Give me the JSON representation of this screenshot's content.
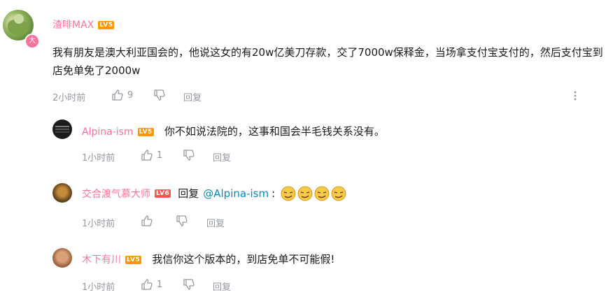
{
  "main_comment": {
    "username": "渣啡MAX",
    "level": "LV5",
    "avatar_badge": "大",
    "content": "我有朋友是澳大利亚国会的，他说这女的有20w亿美刀存款，交了7000w保释金，当场拿支付宝支付的，然后支付宝到店免单免了2000w",
    "time": "2小时前",
    "likes": "9",
    "reply_label": "回复",
    "more_icon": "more-vertical-icon"
  },
  "replies": [
    {
      "username": "Alpina-ism",
      "level": "LV5",
      "content": "你不如说法院的，这事和国会半毛钱关系没有。",
      "time": "1小时前",
      "likes": "1",
      "reply_label": "回复"
    },
    {
      "username": "交合渡气慕大师",
      "level": "LV6",
      "reply_prefix": "回复",
      "mention": "@Alpina-ism",
      "content": ":",
      "emojis": [
        "face-emoji",
        "face-emoji",
        "face-emoji",
        "face-emoji"
      ],
      "time": "1小时前",
      "likes": "",
      "reply_label": "回复"
    },
    {
      "username": "木下有川",
      "level": "LV5",
      "content": "我信你这个版本的，到店免单不可能假!",
      "time": "1小时前",
      "likes": "1",
      "reply_label": "回复"
    }
  ],
  "colors": {
    "username": "#fb7299",
    "meta": "#9499a0",
    "mention": "#008ac5",
    "lv5": "#ff9500",
    "lv6": "#fe5454"
  }
}
